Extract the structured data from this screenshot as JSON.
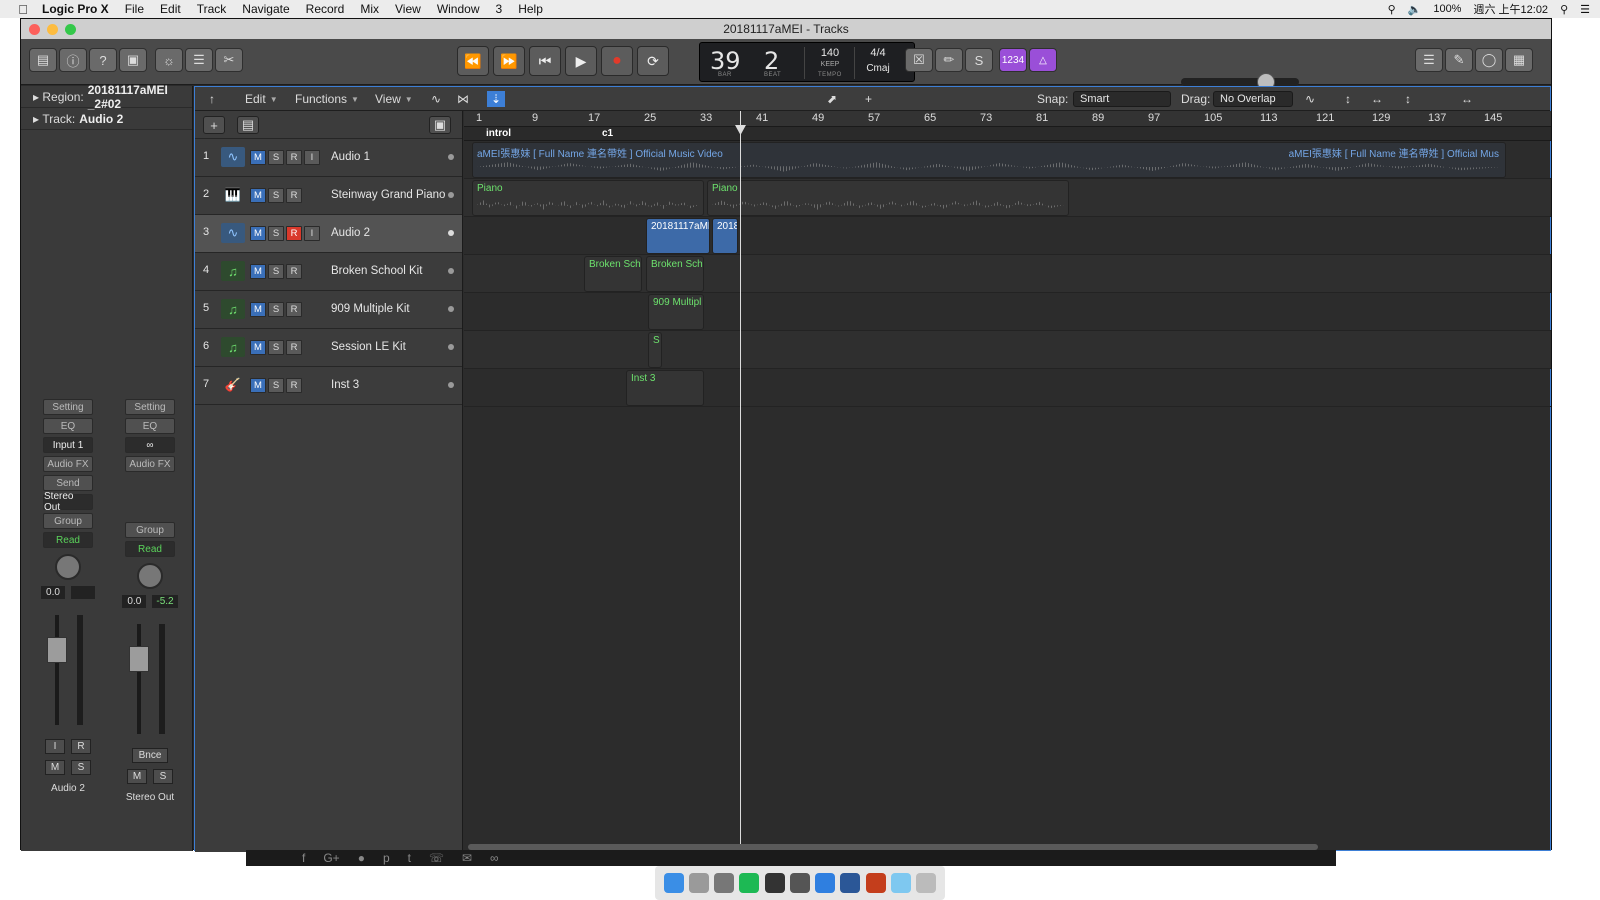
{
  "menubar": {
    "app_name": "Logic Pro X",
    "items": [
      "File",
      "Edit",
      "Track",
      "Navigate",
      "Record",
      "Mix",
      "View",
      "Window",
      "3",
      "Help"
    ],
    "battery": "100%",
    "clock": "週六 上午12:02"
  },
  "window": {
    "title": "20181117aMEI - Tracks"
  },
  "lcd": {
    "bar": "39",
    "beat": "2",
    "bar_label": "BAR",
    "beat_label": "BEAT",
    "tempo": "140",
    "tempo_mode": "KEEP",
    "tempo_label": "TEMPO",
    "time_signature": "4/4",
    "key": "Cmaj"
  },
  "toolbar": {
    "count_in_label": "1234"
  },
  "inspector": {
    "region_label": "Region:",
    "region_name": "20181117aMEI _2#02",
    "track_label": "Track:",
    "track_name": "Audio 2"
  },
  "strips": [
    {
      "setting": "Setting",
      "eq": "EQ",
      "input": "Input 1",
      "audio_fx": "Audio FX",
      "send": "Send",
      "output": "Stereo Out",
      "group": "Group",
      "automation": "Read",
      "volume": "0.0",
      "peak": "",
      "name": "Audio 2",
      "i_label": "I",
      "r_label": "R",
      "m_label": "M",
      "s_label": "S"
    },
    {
      "setting": "Setting",
      "eq": "EQ",
      "audio_fx": "Audio FX",
      "group": "Group",
      "automation": "Read",
      "volume": "0.0",
      "peak": "-5.2",
      "bounce": "Bnce",
      "name": "Stereo Out",
      "m_label": "M",
      "s_label": "S"
    }
  ],
  "localbar": {
    "edit": "Edit",
    "functions": "Functions",
    "view": "View",
    "snap_label": "Snap:",
    "snap_value": "Smart",
    "drag_label": "Drag:",
    "drag_value": "No Overlap"
  },
  "ruler": [
    "1",
    "9",
    "17",
    "25",
    "33",
    "41",
    "49",
    "57",
    "65",
    "73",
    "81",
    "89",
    "97",
    "105",
    "113",
    "121",
    "129",
    "137",
    "145"
  ],
  "markers": [
    "introl",
    "c1"
  ],
  "tracks": [
    {
      "num": "1",
      "name": "Audio 1",
      "type": "audio",
      "icon": "waveform-icon",
      "m": "M",
      "s": "S",
      "r": "R",
      "i": "I",
      "r_on": false
    },
    {
      "num": "2",
      "name": "Steinway Grand Piano",
      "type": "piano",
      "icon": "piano-icon",
      "m": "M",
      "s": "S",
      "r": "R",
      "i": "",
      "r_on": false
    },
    {
      "num": "3",
      "name": "Audio 2",
      "type": "audio",
      "icon": "waveform-icon",
      "m": "M",
      "s": "S",
      "r": "R",
      "i": "I",
      "r_on": true
    },
    {
      "num": "4",
      "name": "Broken School Kit",
      "type": "drum",
      "icon": "drum-note-icon",
      "m": "M",
      "s": "S",
      "r": "R",
      "i": "",
      "r_on": false
    },
    {
      "num": "5",
      "name": "909 Multiple Kit",
      "type": "drum",
      "icon": "drum-note-icon",
      "m": "M",
      "s": "S",
      "r": "R",
      "i": "",
      "r_on": false
    },
    {
      "num": "6",
      "name": "Session LE Kit",
      "type": "drum",
      "icon": "drum-note-icon",
      "m": "M",
      "s": "S",
      "r": "R",
      "i": "",
      "r_on": false
    },
    {
      "num": "7",
      "name": "Inst 3",
      "type": "guitar",
      "icon": "guitar-icon",
      "m": "M",
      "s": "S",
      "r": "R",
      "i": "",
      "r_on": false
    }
  ],
  "regions": {
    "audio1_left": "aMEI張惠妹 [ Full Name 連名帶姓 ] Official Music Video",
    "audio1_right": "aMEI張惠妹 [ Full Name 連名帶姓 ] Official Mus",
    "piano1": "Piano",
    "piano2": "Piano",
    "audio2_a": "20181117aMEI",
    "audio2_b": "2018",
    "broken1": "Broken Sch",
    "broken2": "Broken Sch",
    "kit909": "909 Multipl",
    "session": "S",
    "inst3": "Inst 3"
  },
  "colors": {
    "selection_blue": "#3d7fd6",
    "record_red": "#d9392b",
    "midi_green": "#6de26d",
    "audio_blue": "#74a6e6",
    "count_in_purple": "#9a4fd8"
  }
}
